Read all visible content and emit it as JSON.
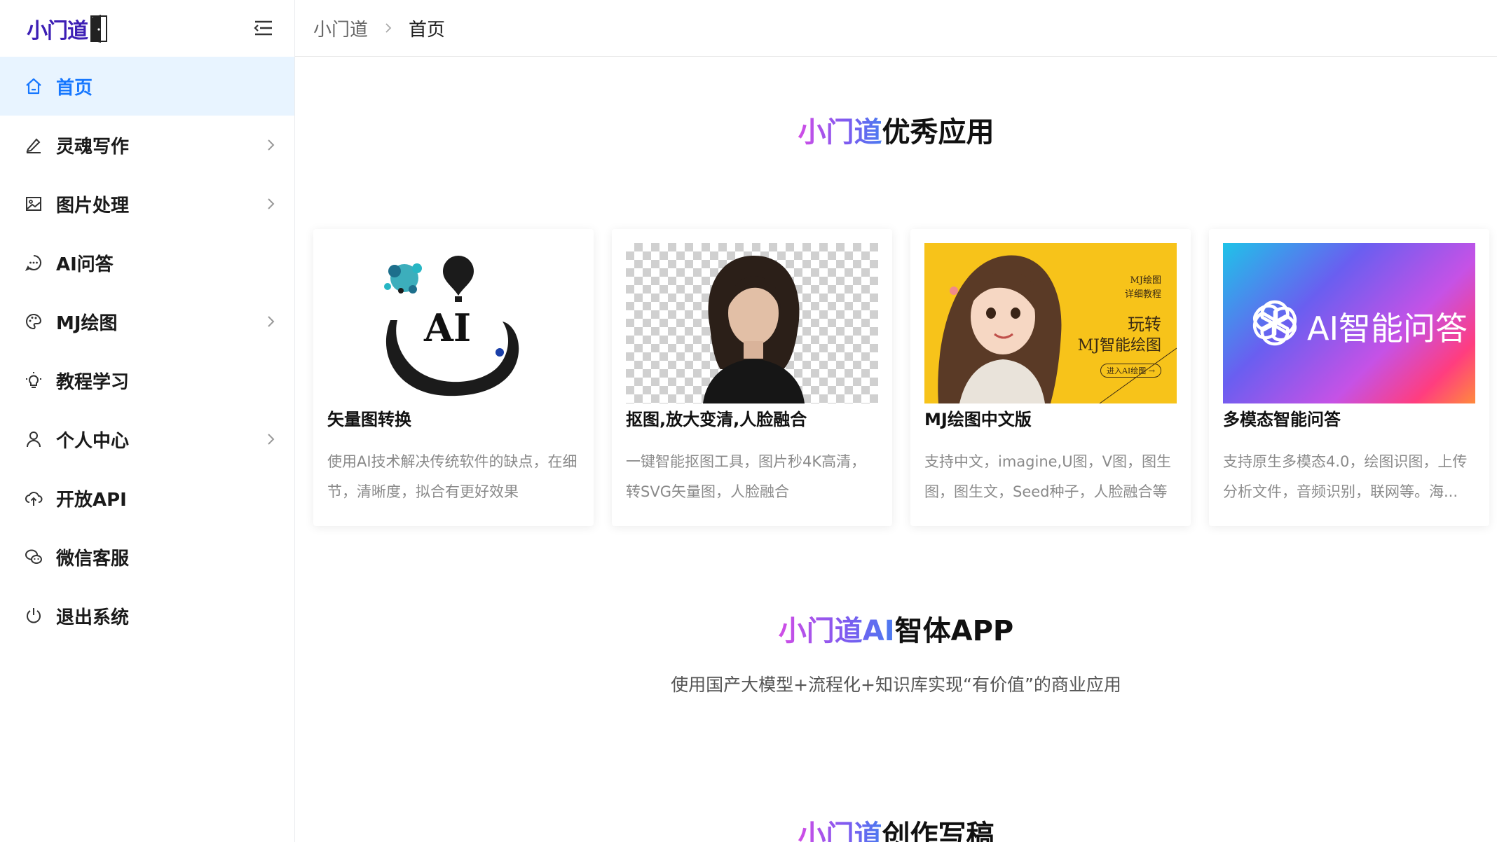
{
  "brand": {
    "logo_text": "小门道",
    "accent": "#1677ff"
  },
  "sidebar": {
    "items": [
      {
        "label": "首页",
        "icon": "home-icon",
        "active": true,
        "has_arrow": false
      },
      {
        "label": "灵魂写作",
        "icon": "pen-icon",
        "active": false,
        "has_arrow": true
      },
      {
        "label": "图片处理",
        "icon": "image-icon",
        "active": false,
        "has_arrow": true
      },
      {
        "label": "AI问答",
        "icon": "chat-icon",
        "active": false,
        "has_arrow": false
      },
      {
        "label": "MJ绘图",
        "icon": "palette-icon",
        "active": false,
        "has_arrow": true
      },
      {
        "label": "教程学习",
        "icon": "bulb-icon",
        "active": false,
        "has_arrow": false
      },
      {
        "label": "个人中心",
        "icon": "user-icon",
        "active": false,
        "has_arrow": true
      },
      {
        "label": "开放API",
        "icon": "cloud-upload-icon",
        "active": false,
        "has_arrow": false
      },
      {
        "label": "微信客服",
        "icon": "wechat-icon",
        "active": false,
        "has_arrow": false
      },
      {
        "label": "退出系统",
        "icon": "power-icon",
        "active": false,
        "has_arrow": false
      }
    ]
  },
  "breadcrumb": {
    "root": "小门道",
    "current": "首页"
  },
  "section1": {
    "title_highlight": "小门道",
    "title_rest": "优秀应用"
  },
  "cards": [
    {
      "title": "矢量图转换",
      "desc": "使用AI技术解决传统软件的缺点，在细节，清晰度，拟合有更好效果",
      "image_text": "AI"
    },
    {
      "title": "抠图,放大变清,人脸融合",
      "desc": "一键智能抠图工具，图片秒4K高清，转SVG矢量图，人脸融合"
    },
    {
      "title": "MJ绘图中文版",
      "desc": "支持中文，imagine,U图，V图，图生图，图生文，Seed种子，人脸融合等",
      "image_lines": [
        "MJ绘图",
        "详细教程",
        "玩转",
        "MJ智能绘图",
        "进入AI绘图 →"
      ]
    },
    {
      "title": "多模态智能问答",
      "desc": "支持原生多模态4.0，绘图识图，上传分析文件，音频识别，联网等。海...",
      "image_text": "AI智能问答"
    }
  ],
  "section2": {
    "title_highlight": "小门道AI",
    "title_rest": "智体APP",
    "subtitle": "使用国产大模型+流程化+知识库实现“有价值”的商业应用"
  },
  "section3": {
    "title_highlight": "小门道",
    "title_rest": "创作写稿"
  }
}
